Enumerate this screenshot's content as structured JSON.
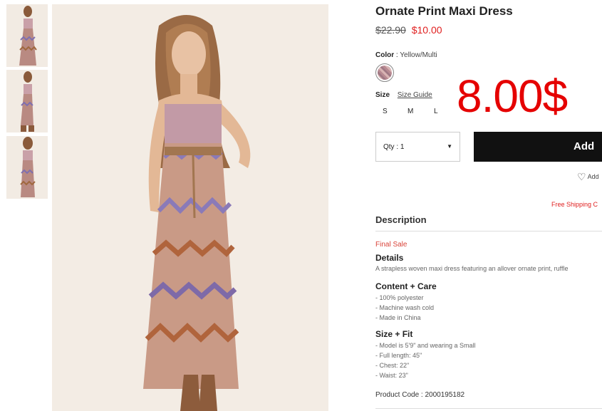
{
  "product": {
    "title": "Ornate Print Maxi Dress",
    "price_original": "$22.90",
    "price_sale": "$10.00",
    "overlay_price": "8.00$"
  },
  "color": {
    "label": "Color",
    "separator": ":",
    "value": "Yellow/Multi"
  },
  "size": {
    "label": "Size",
    "guide": "Size Guide",
    "options": [
      "S",
      "M",
      "L"
    ]
  },
  "quantity": {
    "label": "Qty : 1"
  },
  "add_button": {
    "label": "Add"
  },
  "wishlist": {
    "label": "Add"
  },
  "shipping": {
    "text": "Free Shipping C"
  },
  "description": {
    "heading": "Description",
    "final_sale": "Final Sale",
    "details_heading": "Details",
    "details_text": "A strapless woven maxi dress featuring an allover ornate print, ruffle",
    "care_heading": "Content + Care",
    "care_items": [
      "- 100% polyester",
      "- Machine wash cold",
      "- Made in China"
    ],
    "fit_heading": "Size + Fit",
    "fit_items": [
      "- Model is 5'9\" and wearing a Small",
      "- Full length: 45\"",
      "- Chest: 22\"",
      "- Waist: 23\""
    ],
    "product_code": "Product Code : 2000195182"
  },
  "colors": {
    "sale_red": "#e02020",
    "overlay_red": "#e50000",
    "button_black": "#111111"
  }
}
